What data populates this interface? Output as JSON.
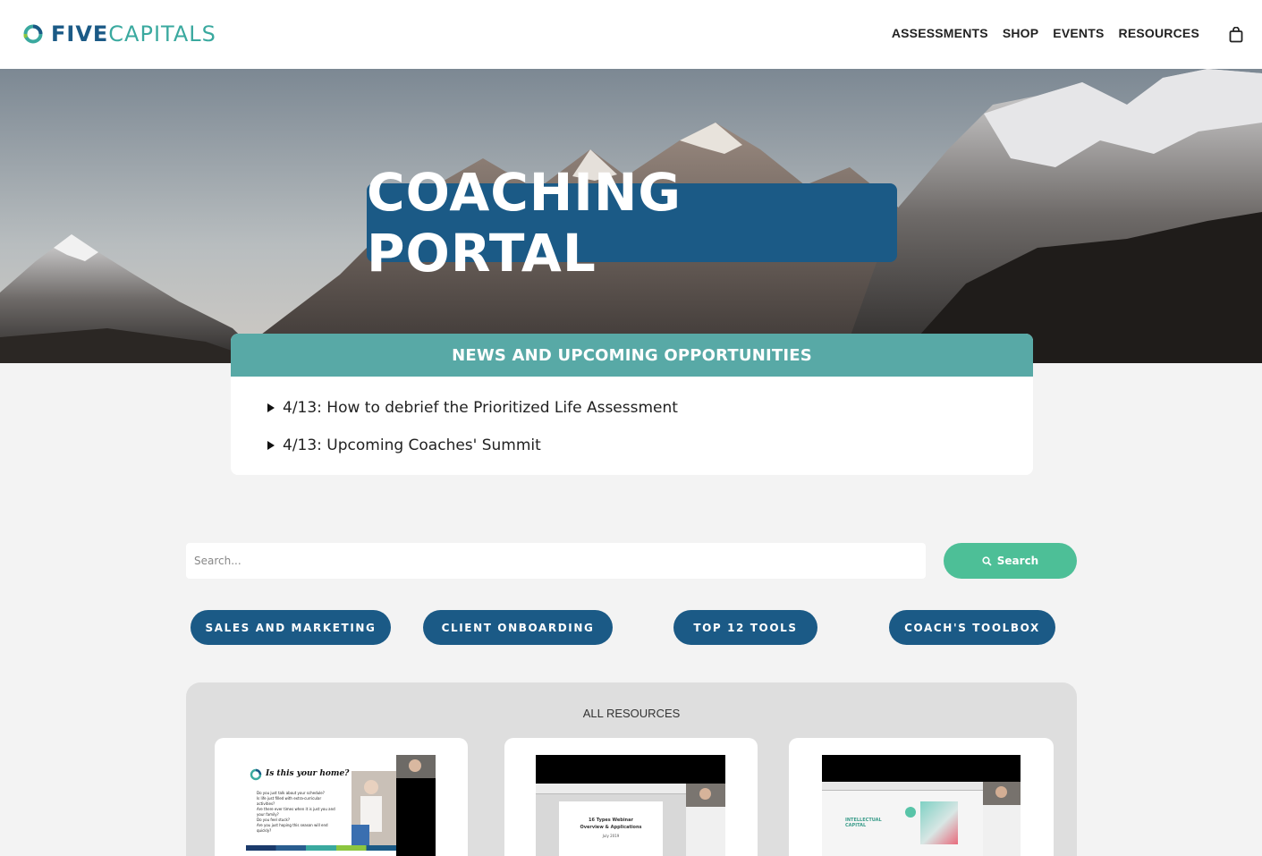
{
  "header": {
    "logo_five": "FIVE",
    "logo_capitals": "CAPITALS",
    "nav": [
      "ASSESSMENTS",
      "SHOP",
      "EVENTS",
      "RESOURCES"
    ],
    "cart_icon": "shopping-bag-icon"
  },
  "hero": {
    "title": "COACHING PORTAL"
  },
  "news": {
    "title": "NEWS AND UPCOMING OPPORTUNITIES",
    "items": [
      "4/13: How to debrief the Prioritized Life Assessment",
      "4/13: Upcoming Coaches' Summit"
    ]
  },
  "search": {
    "placeholder": "Search...",
    "button_label": "Search"
  },
  "categories": [
    "SALES AND MARKETING",
    "CLIENT ONBOARDING",
    "TOP 12 TOOLS",
    "COACH'S TOOLBOX"
  ],
  "resources": {
    "title": "ALL RESOURCES",
    "cards": [
      {
        "thumb_heading": "Is this your home?",
        "thumb_bullets": [
          "Do you just talk about your schedule?",
          "Is life just filled with extra-curricular activities?",
          "Are there ever times when it is just you and your family?",
          "Do you feel stuck?",
          "Are you just hoping this season will end quickly?"
        ]
      },
      {
        "thumb_title": "16 Types Webinar",
        "thumb_subtitle": "Overview & Applications",
        "thumb_date": "July 2019"
      },
      {
        "thumb_heading": "INTELLECTUAL CAPITAL"
      }
    ]
  },
  "colors": {
    "brand_navy": "#1b5a86",
    "brand_teal": "#58a9a6",
    "search_green": "#4dbf97",
    "page_bg": "#f3f3f3"
  }
}
